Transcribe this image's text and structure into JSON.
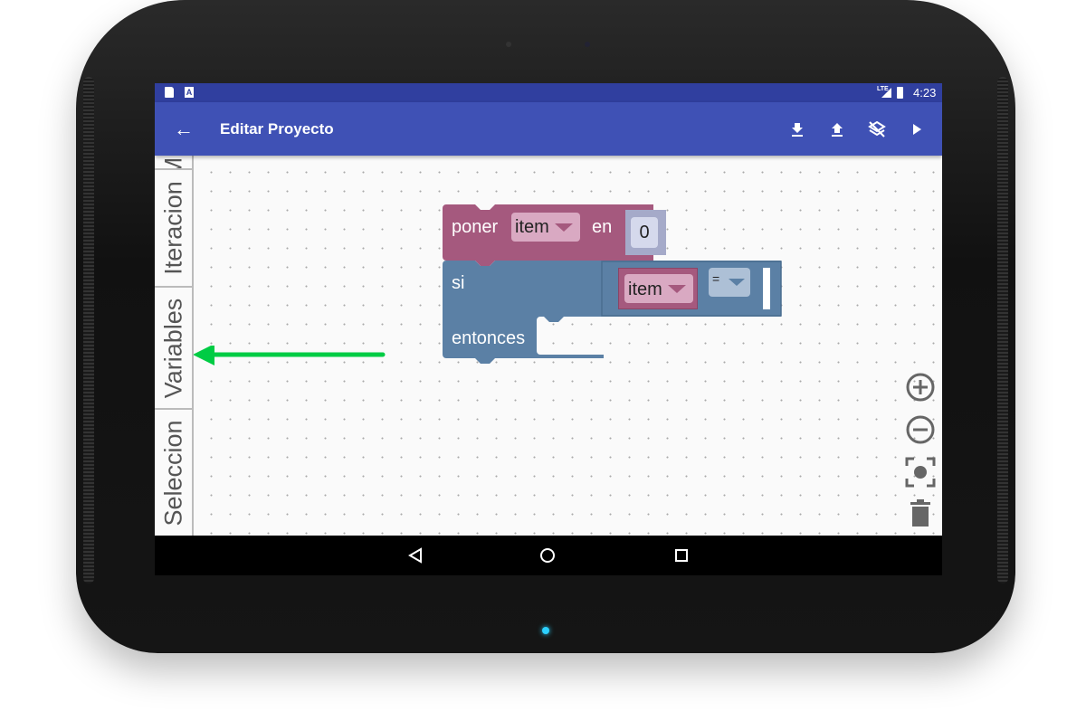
{
  "status_bar": {
    "time": "4:23",
    "network": "LTE",
    "icons": [
      "sd-card-icon",
      "text-a-icon",
      "signal-icon",
      "battery-icon"
    ]
  },
  "app_bar": {
    "title": "Editar Proyecto",
    "back_icon": "arrow-back-icon",
    "actions": [
      "download-icon",
      "upload-icon",
      "layers-off-icon",
      "play-icon"
    ]
  },
  "toolbox": {
    "tabs": [
      {
        "label": "M"
      },
      {
        "label": "Iteracion"
      },
      {
        "label": "Variables"
      },
      {
        "label": "Seleccion"
      }
    ]
  },
  "blocks": {
    "set": {
      "keyword": "poner",
      "variable": "item",
      "to": "en",
      "value": "0",
      "color": "#a5597e"
    },
    "if": {
      "keyword": "si",
      "then": "entonces",
      "compare_var": "item",
      "operator": "=",
      "color": "#5b80a5"
    }
  },
  "annotation": {
    "arrow_color": "#00cc44"
  },
  "controls": [
    "zoom-in-icon",
    "zoom-out-icon",
    "recenter-icon",
    "trash-icon"
  ],
  "nav": [
    "back-icon",
    "home-icon",
    "recents-icon"
  ]
}
